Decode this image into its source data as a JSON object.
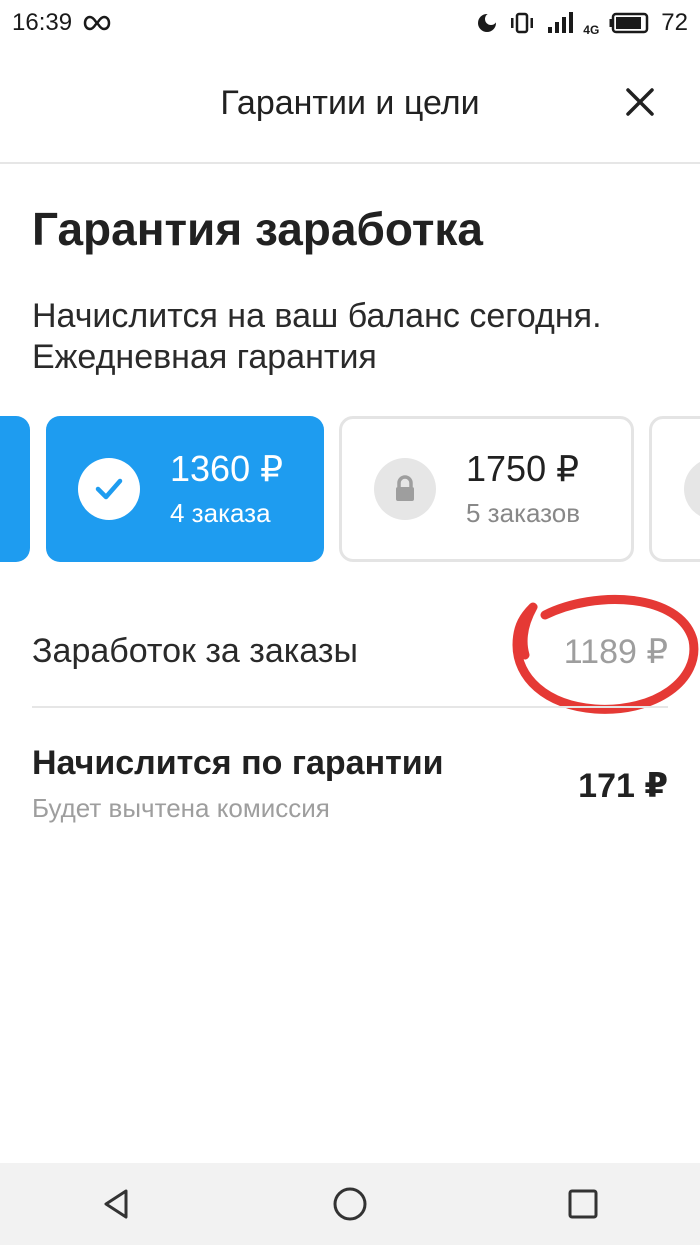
{
  "status_bar": {
    "time": "16:39",
    "battery": "72",
    "network": "4G"
  },
  "header": {
    "title": "Гарантии и цели"
  },
  "page": {
    "title": "Гарантия заработка",
    "subtitle": "Начислится на ваш баланс сегодня. Ежедневная гарантия"
  },
  "cards": [
    {
      "amount": "1360 ₽",
      "orders": "4 заказа",
      "state": "achieved"
    },
    {
      "amount": "1750 ₽",
      "orders": "5 заказов",
      "state": "locked"
    }
  ],
  "summary": {
    "earned_label": "Заработок за заказы",
    "earned_value": "1189 ₽",
    "guarantee_label": "Начислится по гарантии",
    "guarantee_note": "Будет вычтена комиссия",
    "guarantee_value": "171 ₽"
  },
  "colors": {
    "accent": "#1e9cf0",
    "annotation": "#e53935"
  }
}
